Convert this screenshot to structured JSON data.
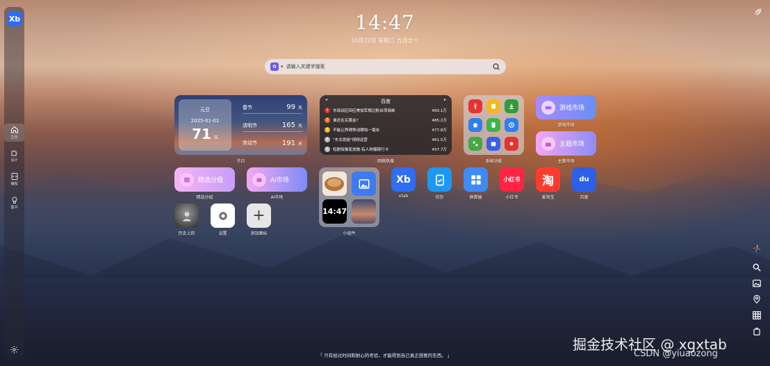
{
  "sidebar": {
    "logo": "Xb",
    "items": [
      {
        "label": "主页",
        "icon": "home-icon"
      },
      {
        "label": "设计",
        "icon": "puzzle-icon"
      },
      {
        "label": "编程",
        "icon": "code-icon"
      },
      {
        "label": "图书",
        "icon": "brain-icon"
      }
    ],
    "settings_icon": "gear-icon"
  },
  "clock": {
    "time": "14:47",
    "date": "10月22日  星期二  九月廿十"
  },
  "search": {
    "engine_icon": "paw-icon",
    "placeholder": "请输入关键字搜索"
  },
  "festival": {
    "caption": "节日",
    "main": {
      "name": "元旦",
      "date": "2025-01-01",
      "days": "71",
      "unit": "天"
    },
    "list": [
      {
        "name": "春节",
        "days": "99",
        "unit": "天"
      },
      {
        "name": "清明节",
        "days": "165",
        "unit": "天"
      },
      {
        "name": "劳动节",
        "days": "191",
        "unit": "天"
      }
    ]
  },
  "hot": {
    "caption": "网络热搜",
    "title": "百度",
    "prev": "◂",
    "next": "▸",
    "items": [
      {
        "rank": "1",
        "text": "东部战区回应美加军舰过航台湾海峡",
        "heat": "493.1万",
        "color": "#e0302c"
      },
      {
        "rank": "2",
        "text": "谁还在买黄金?",
        "heat": "485.2万",
        "color": "#f07a16"
      },
      {
        "rank": "3",
        "text": "不能让界碑移动哪怕一毫米",
        "heat": "477.8万",
        "color": "#f2b41c"
      },
      {
        "rank": "4",
        "text": "\"东北雨姐\"视频运营",
        "heat": "461.5万",
        "color": "#bdbdbd"
      },
      {
        "rank": "5",
        "text": "短剧吸猫变放鼓:有人刷爆银行卡",
        "heat": "457.7万",
        "color": "#bdbdbd"
      }
    ]
  },
  "system": {
    "caption": "系统功能"
  },
  "market": [
    {
      "label": "游戏市场",
      "caption": "游戏市场"
    },
    {
      "label": "主题市场",
      "caption": "主题市场"
    },
    {
      "label": "精选分组",
      "caption": "精选分组"
    },
    {
      "label": "AI市场",
      "caption": "AI市场"
    }
  ],
  "widgets": {
    "caption": "小组件",
    "clock": "14:47"
  },
  "apps": [
    {
      "label": "xtab",
      "glyph": "Xb"
    },
    {
      "label": "待办",
      "glyph": ""
    },
    {
      "label": "换算器",
      "glyph": ""
    },
    {
      "label": "小红书",
      "glyph": "小红书"
    },
    {
      "label": "爱淘宝",
      "glyph": "淘"
    },
    {
      "label": "百度",
      "glyph": "du"
    },
    {
      "label": "历史上的",
      "glyph": ""
    },
    {
      "label": "设置",
      "glyph": ""
    },
    {
      "label": "添加图标",
      "glyph": "+"
    }
  ],
  "right_tools": [
    "pinwheel-icon",
    "search-icon",
    "image-icon",
    "location-icon",
    "grid-icon",
    "bag-icon"
  ],
  "quote": "「 只有经过时间和耐心的考验，才能得到自己真正想要的东西。 」",
  "watermark": {
    "main": "掘金技术社区 @ xgxtab",
    "sub": "CSDN @yiuaozong"
  },
  "colors": {
    "accent": "#2d6cf5",
    "xiaohongshu": "#ff2442",
    "taobao": "#ff3b2f",
    "baidu": "#2e5fe8"
  }
}
